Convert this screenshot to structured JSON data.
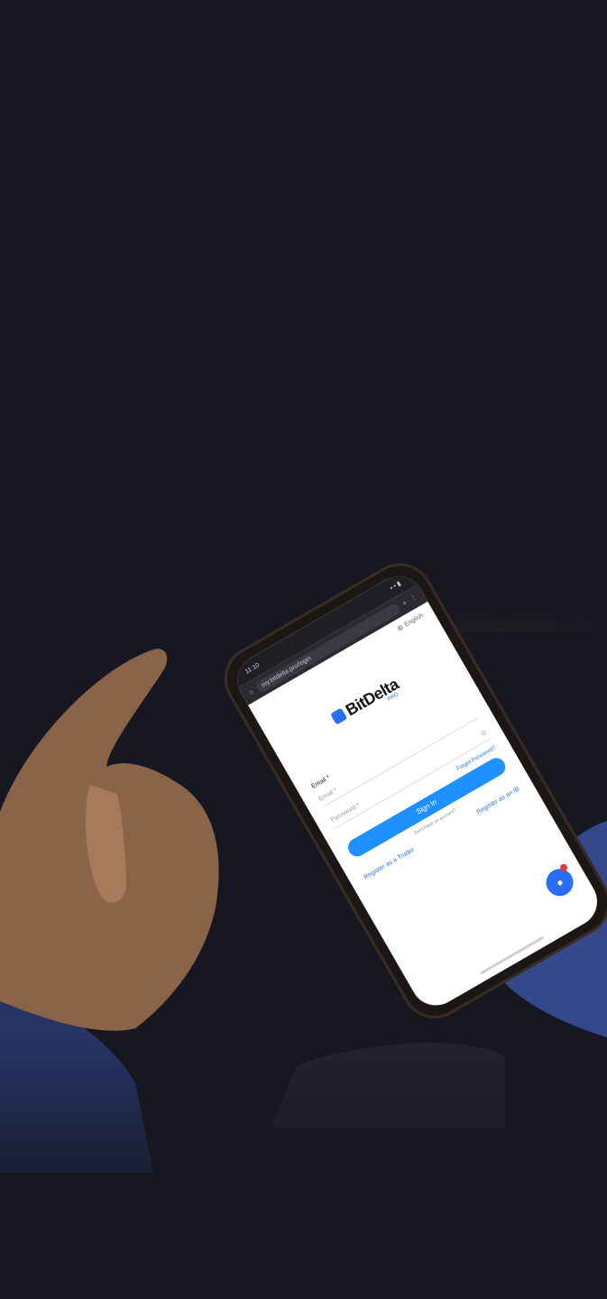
{
  "phone": {
    "status_time": "11:10",
    "url": "my.bitdelta.pro/login",
    "language": "English",
    "brand": "BitDelta",
    "brand_sub": "PRO",
    "email_label": "Email *",
    "email_placeholder": "Email *",
    "password_placeholder": "Password *",
    "forgot_password": "Forgot Password?",
    "sign_in": "Sign In",
    "no_account": "Don't have an account?",
    "register_trader": "Register as a Trader",
    "register_ib": "Register as an IB",
    "chat_badge": "1"
  },
  "colors": {
    "background": "#171721",
    "accent_blue": "#1e90ff",
    "brand_blue": "#2b6ef6",
    "sleeve": "#3a4f8f"
  }
}
